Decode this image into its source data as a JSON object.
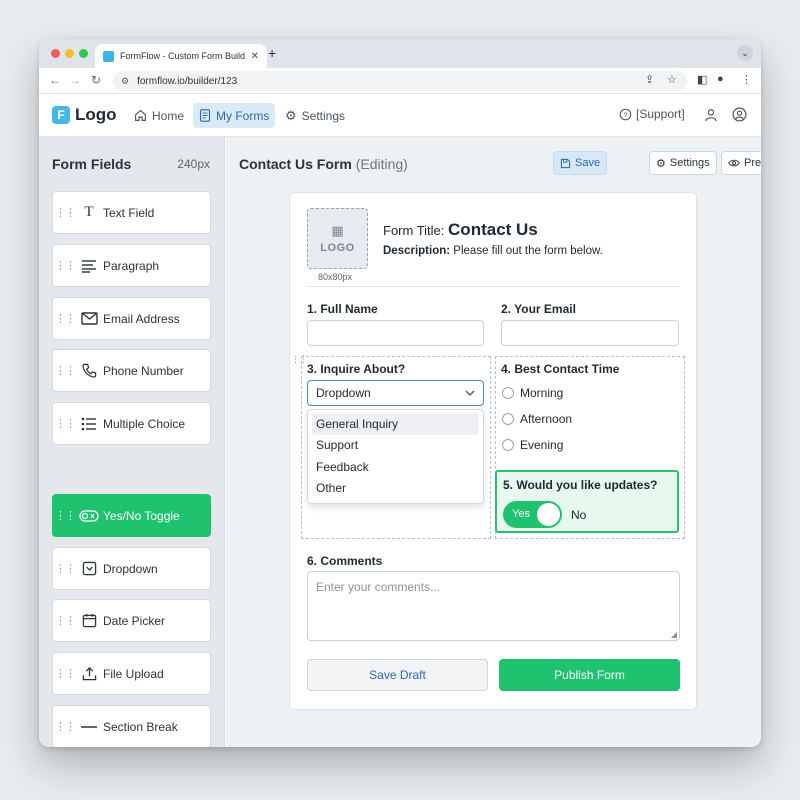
{
  "browser": {
    "tab_title": "FormFlow - Custom Form Builder",
    "url": "formflow.io/builder/123",
    "traffic_colors": [
      "#ee5f57",
      "#f6bd2f",
      "#30c84a"
    ]
  },
  "header": {
    "logo_letter": "F",
    "logo_text": "Logo",
    "nav": [
      {
        "label": "Home",
        "icon": "home-icon"
      },
      {
        "label": "My Forms",
        "icon": "forms-icon",
        "active": true
      },
      {
        "label": "Settings",
        "icon": "gear-icon"
      }
    ],
    "support_label": "[Support]"
  },
  "sidebar": {
    "title": "Form Fields",
    "width_label": "240px",
    "items": [
      {
        "label": "Text Field",
        "icon": "text-icon"
      },
      {
        "label": "Paragraph",
        "icon": "paragraph-icon"
      },
      {
        "label": "Email Address",
        "icon": "mail-icon"
      },
      {
        "label": "Phone Number",
        "icon": "phone-icon"
      },
      {
        "label": "Multiple Choice",
        "icon": "list-icon"
      },
      {
        "label": "Yes/No Toggle",
        "icon": "toggle-icon",
        "active": true
      },
      {
        "label": "Dropdown",
        "icon": "dropdown-icon"
      },
      {
        "label": "Date Picker",
        "icon": "calendar-icon"
      },
      {
        "label": "File Upload",
        "icon": "upload-icon"
      },
      {
        "label": "Section Break",
        "icon": "divider-icon"
      }
    ]
  },
  "main": {
    "title": "Contact Us Form",
    "status": "(Editing)",
    "toolbar": {
      "save": "Save",
      "settings": "Settings",
      "preview": "Preview"
    }
  },
  "form": {
    "logo_placeholder": "LOGO",
    "logo_size": "80x80px",
    "title_prefix": "Form Title:",
    "title_value": "Contact Us",
    "desc_prefix": "Description:",
    "desc_value": "Please fill out the form below.",
    "q1": "1. Full Name",
    "q2": "2. Your Email",
    "q3": "3. Inquire About?",
    "dropdown_value": "Dropdown",
    "dropdown_options": [
      "General Inquiry",
      "Support",
      "Feedback",
      "Other"
    ],
    "q4": "4. Best Contact Time",
    "time_options": [
      "Morning",
      "Afternoon",
      "Evening"
    ],
    "q5": "5. Would you like updates?",
    "toggle_yes": "Yes",
    "toggle_no": "No",
    "toggle_on": true,
    "q6": "6. Comments",
    "comments_placeholder": "Enter your comments...",
    "save_draft": "Save Draft",
    "publish": "Publish Form"
  },
  "colors": {
    "accent_green": "#1fc36f",
    "accent_blue": "#2d6aa8"
  }
}
